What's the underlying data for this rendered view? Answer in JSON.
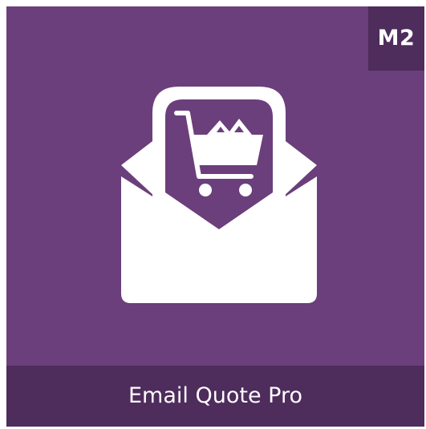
{
  "badge": {
    "text": "M2"
  },
  "footer": {
    "title": "Email Quote Pro"
  },
  "colors": {
    "background": "#6b3f7b",
    "band": "#4e2c5c",
    "foreground": "#ffffff"
  },
  "icons": {
    "main": "envelope-with-cart-icon"
  }
}
